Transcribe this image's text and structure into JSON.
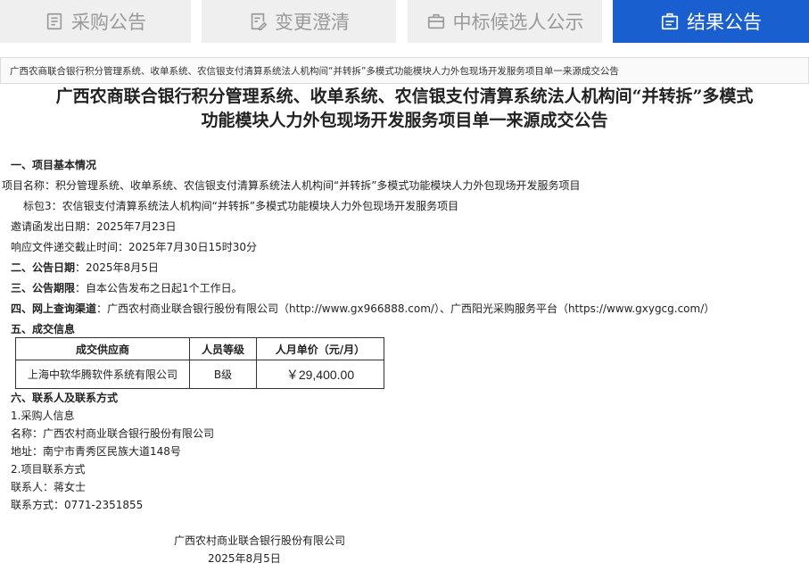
{
  "tabs": [
    {
      "label": "采购公告",
      "icon": "document-icon"
    },
    {
      "label": "变更澄清",
      "icon": "edit-document-icon"
    },
    {
      "label": "中标候选人公示",
      "icon": "suitcase-icon"
    },
    {
      "label": "结果公告",
      "icon": "notice-icon"
    }
  ],
  "breadcrumb": "广西农商联合银行积分管理系统、收单系统、农信银支付清算系统法人机构间“并转拆”多模式功能模块人力外包现场开发服务项目单一来源成交公告",
  "title_line1": "广西农商联合银行积分管理系统、收单系统、农信银支付清算系统法人机构间“并转拆”多模式",
  "title_line2": "功能模块人力外包现场开发服务项目单一来源成交公告",
  "sec1": {
    "heading": "一、项目基本情况",
    "project_name": "项目名称：积分管理系统、收单系统、农信银支付清算系统法人机构间“并转拆”多模式功能模块人力外包现场开发服务项目",
    "package": "标包3：农信银支付清算系统法人机构间“并转拆”多模式功能模块人力外包现场开发服务项目",
    "invite_date": "邀请函发出日期：2025年7月23日",
    "deadline": "响应文件递交截止时间：2025年7月30日15时30分"
  },
  "sec2": {
    "label": "二、公告日期",
    "value": "：2025年8月5日"
  },
  "sec3": {
    "label": "三、公告期限",
    "value": "：自本公告发布之日起1个工作日。"
  },
  "sec4": {
    "label": "四、网上查询渠道",
    "value": "：广西农村商业联合银行股份有限公司（http://www.gx966888.com/）、广西阳光采购服务平台（https://www.gxygcg.com/）"
  },
  "sec5": {
    "heading": "五、成交信息",
    "columns": [
      "成交供应商",
      "人员等级",
      "人月单价（元/月）"
    ],
    "row": {
      "supplier": "上海中软华腾软件系统有限公司",
      "level": "B级",
      "price": "￥29,400.00"
    }
  },
  "sec6": {
    "heading": "六、联系人及联系方式",
    "purchaser_heading": "1.采购人信息",
    "name": "名称：广西农村商业联合银行股份有限公司",
    "address": "地址：南宁市青秀区民族大道148号",
    "contact_heading": "2.项目联系方式",
    "person": "联系人：蒋女士",
    "phone": "联系方式：0771-2351855"
  },
  "signature": {
    "org": "广西农村商业联合银行股份有限公司",
    "date": "2025年8月5日"
  }
}
